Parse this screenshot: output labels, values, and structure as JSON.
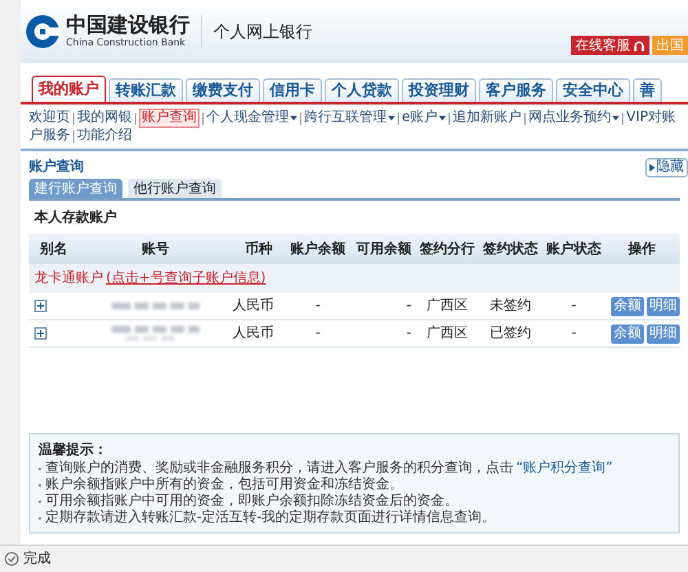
{
  "header": {
    "bank_name": "中国建设银行",
    "bank_name_en": "China Construction Bank",
    "product": "个人网上银行",
    "buttons": [
      {
        "label": "在线客服",
        "kind": "service"
      },
      {
        "label": "出国",
        "kind": "plain"
      }
    ]
  },
  "tabs": [
    {
      "label": "我的账户",
      "selected": true
    },
    {
      "label": "转账汇款",
      "selected": false
    },
    {
      "label": "缴费支付",
      "selected": false
    },
    {
      "label": "信用卡",
      "selected": false
    },
    {
      "label": "个人贷款",
      "selected": false
    },
    {
      "label": "投资理财",
      "selected": false
    },
    {
      "label": "客户服务",
      "selected": false
    },
    {
      "label": "安全中心",
      "selected": false
    },
    {
      "label": "善",
      "selected": false
    }
  ],
  "subnav_rows": [
    [
      {
        "label": "欢迎页",
        "selected": false,
        "dropdown": false
      },
      {
        "label": "我的网银",
        "selected": false,
        "dropdown": false
      },
      {
        "label": "账户查询",
        "selected": true,
        "dropdown": false
      },
      {
        "label": "个人现金管理",
        "selected": false,
        "dropdown": true
      },
      {
        "label": "跨行互联管理",
        "selected": false,
        "dropdown": true
      },
      {
        "label": "e账户",
        "selected": false,
        "dropdown": true
      },
      {
        "label": "追加新账户",
        "selected": false,
        "dropdown": false
      },
      {
        "label": "网点业务预约",
        "selected": false,
        "dropdown": true
      },
      {
        "label": "VIP对账",
        "selected": false,
        "dropdown": false
      }
    ],
    [
      {
        "label": "户服务",
        "selected": false,
        "dropdown": false
      },
      {
        "label": "功能介绍",
        "selected": false,
        "dropdown": false
      }
    ]
  ],
  "section": {
    "title": "账户查询",
    "hide_label": "隐藏",
    "subtabs": [
      {
        "label": "建行账户查询",
        "selected": true
      },
      {
        "label": "他行账户查询",
        "selected": false
      }
    ],
    "group_title": "本人存款账户",
    "table": {
      "columns": [
        "别名",
        "账号",
        "币种",
        "账户余额",
        "可用余额",
        "签约分行",
        "签约状态",
        "账户状态",
        "操作"
      ],
      "group_row": {
        "label": "龙卡通账户",
        "hint": "(点击+号查询子账户信息)"
      },
      "rows": [
        {
          "currency": "人民币",
          "balance": "-",
          "available": "-",
          "branch": "广西区",
          "sign_status": "未签约",
          "account_status": "-",
          "actions": [
            "余额",
            "明细"
          ]
        },
        {
          "currency": "人民币",
          "balance": "-",
          "available": "-",
          "branch": "广西区",
          "sign_status": "已签约",
          "account_status": "-",
          "actions": [
            "余额",
            "明细"
          ]
        }
      ]
    }
  },
  "tips": {
    "title": "温馨提示：",
    "items": [
      {
        "text": "查询账户的消费、奖励或非金融服务积分，请进入客户服务的积分查询，点击",
        "link": "“账户积分查询”"
      },
      {
        "text": "账户余额指账户中所有的资金，包括可用资金和冻结资金。"
      },
      {
        "text": "可用余额指账户中可用的资金，即账户余额扣除冻结资金后的资金。"
      },
      {
        "text": "定期存款请进入转账汇款-定活互转-我的定期存款页面进行详情信息查询。"
      }
    ]
  },
  "status_bar": {
    "text": "完成"
  }
}
